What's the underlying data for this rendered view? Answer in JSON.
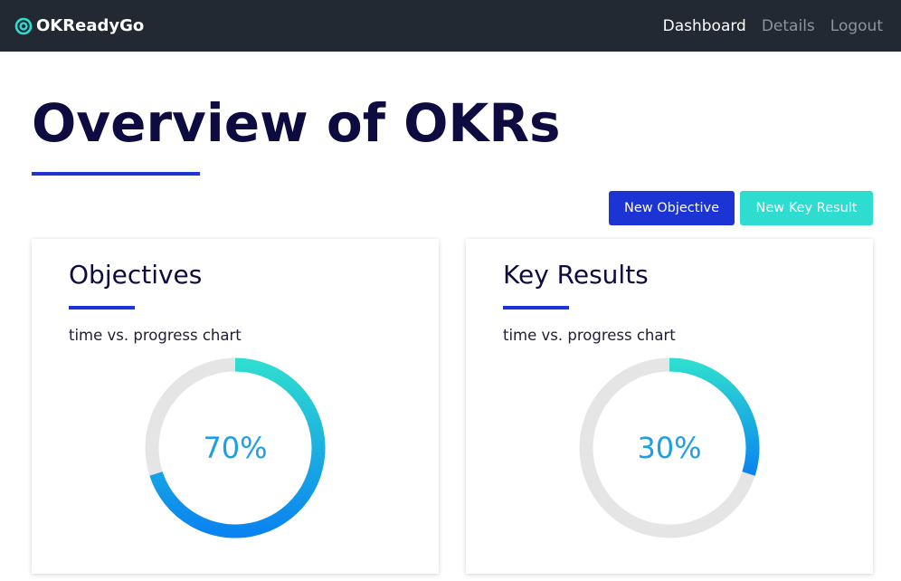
{
  "navbar": {
    "brand": "OKReadyGo",
    "links": [
      {
        "label": "Dashboard",
        "active": true
      },
      {
        "label": "Details",
        "active": false
      },
      {
        "label": "Logout",
        "active": false
      }
    ]
  },
  "header": {
    "title": "Overview of OKRs"
  },
  "actions": {
    "new_objective": "New Objective",
    "new_key_result": "New Key Result"
  },
  "cards": [
    {
      "title": "Objectives",
      "subtitle": "time vs. progress chart",
      "progress_label": "70%",
      "progress": 0.7
    },
    {
      "title": "Key Results",
      "subtitle": "time vs. progress chart",
      "progress_label": "30%",
      "progress": 0.3
    }
  ],
  "colors": {
    "navbar_bg": "#222933",
    "primary": "#1c34d4",
    "accent": "#2edcd0",
    "gauge_start": "#2edcd0",
    "gauge_end": "#0a84f0",
    "gauge_track": "#e5e5e5",
    "gauge_text": "#1d9ee6"
  }
}
